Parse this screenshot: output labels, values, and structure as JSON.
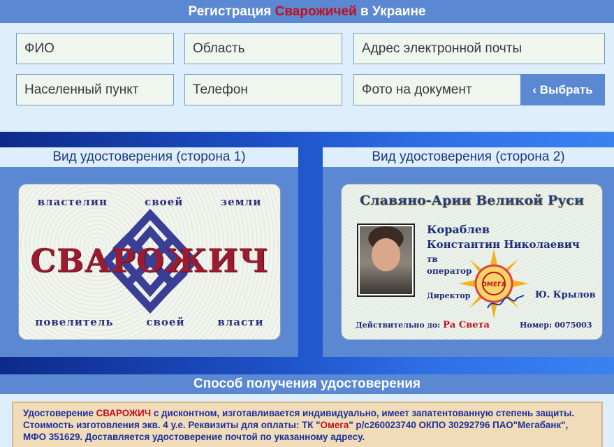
{
  "registration": {
    "title_prefix": "Регистрация ",
    "title_highlight": "Сварожичей",
    "title_suffix": " в Украине",
    "fields": {
      "fio": "ФИО",
      "region": "Область",
      "email": "Адрес электронной почты",
      "locality": "Населенный пункт",
      "phone": "Телефон",
      "photo": "Фото на документ"
    },
    "choose_button": "‹ Выбрать"
  },
  "card_side1": {
    "header": "Вид удостоверения (сторона 1)",
    "top_words": [
      "властелин",
      "своей",
      "земли"
    ],
    "main_word": "СВАРОЖИЧ",
    "bottom_words": [
      "повелитель",
      "своей",
      "власти"
    ]
  },
  "card_side2": {
    "header": "Вид удостоверения (сторона 2)",
    "title": "Славяно-Арии Великой Руси",
    "surname": "Кораблев",
    "name": "Константин Николаевич",
    "role_line1": "тв",
    "role_line2": "оператор",
    "director_label": "Директор",
    "director_name": "Ю. Крылов",
    "valid_label": "Действительно до:",
    "valid_value": "Ра Света",
    "number_label": "Номер:",
    "number_value": "0075003",
    "seal_text": "ОМЕГА"
  },
  "method": {
    "title": "Способ получения удостоверения",
    "p1": "Удостоверение ",
    "p1_red": "СВАРОЖИЧ",
    "p2": " с дисконтном, изготавливается индивидуально, имеет запатентованную степень защиты. Стоимость изготовления экв. 4 у.е. Реквизиты для оплаты: ТК \"",
    "p2_red": "Омега",
    "p3": "\" р/с260023740 ОКПО 30292796 ПАО\"Мегабанк\", МФО 351629. Доставляется удостоверение почтой по указанному адресу."
  },
  "colors": {
    "panel_blue": "#5b88d2",
    "panel_light": "#dfeefc",
    "accent_red": "#c3101b",
    "field_bg": "#eef6ee",
    "notice_bg": "#f0dcb8"
  }
}
